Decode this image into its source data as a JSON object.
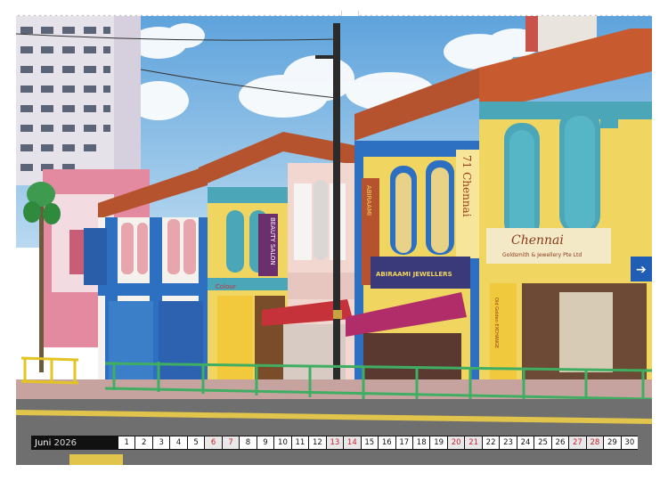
{
  "calendar": {
    "month": "Juni",
    "year": "2026",
    "days": [
      {
        "n": "1",
        "we": false
      },
      {
        "n": "2",
        "we": false
      },
      {
        "n": "3",
        "we": false
      },
      {
        "n": "4",
        "we": false
      },
      {
        "n": "5",
        "we": false
      },
      {
        "n": "6",
        "we": true
      },
      {
        "n": "7",
        "we": true
      },
      {
        "n": "8",
        "we": false
      },
      {
        "n": "9",
        "we": false
      },
      {
        "n": "10",
        "we": false
      },
      {
        "n": "11",
        "we": false
      },
      {
        "n": "12",
        "we": false
      },
      {
        "n": "13",
        "we": true
      },
      {
        "n": "14",
        "we": true
      },
      {
        "n": "15",
        "we": false
      },
      {
        "n": "16",
        "we": false
      },
      {
        "n": "17",
        "we": false
      },
      {
        "n": "18",
        "we": false
      },
      {
        "n": "19",
        "we": false
      },
      {
        "n": "20",
        "we": true
      },
      {
        "n": "21",
        "we": true
      },
      {
        "n": "22",
        "we": false
      },
      {
        "n": "23",
        "we": false
      },
      {
        "n": "24",
        "we": false
      },
      {
        "n": "25",
        "we": false
      },
      {
        "n": "26",
        "we": false
      },
      {
        "n": "27",
        "we": true
      },
      {
        "n": "28",
        "we": true
      },
      {
        "n": "29",
        "we": false
      },
      {
        "n": "30",
        "we": false
      }
    ]
  },
  "signs": {
    "chennai_big": "Chennai",
    "chennai_sub": "Goldsmith & Jewellery Pte Ltd",
    "jewellers": "ABIRAAMI JEWELLERS",
    "beauty": "BEAUTY SALON",
    "vertical_chennai": "71 Chennai",
    "abirami_vertical": "ABIRAAMI",
    "left_sign": "Colour",
    "old_gold": "Old Golden EXCHANGE"
  },
  "colors": {
    "sky": "#7db7e3",
    "roof": "#b5532f",
    "teal": "#4ba6b7",
    "yellow": "#f1d561",
    "blue": "#2d6fc1",
    "pink": "#e7a5ad",
    "magenta": "#b02d6a",
    "red_awning": "#c5323a",
    "railing": "#3fae63",
    "road": "#6f6f6f"
  }
}
